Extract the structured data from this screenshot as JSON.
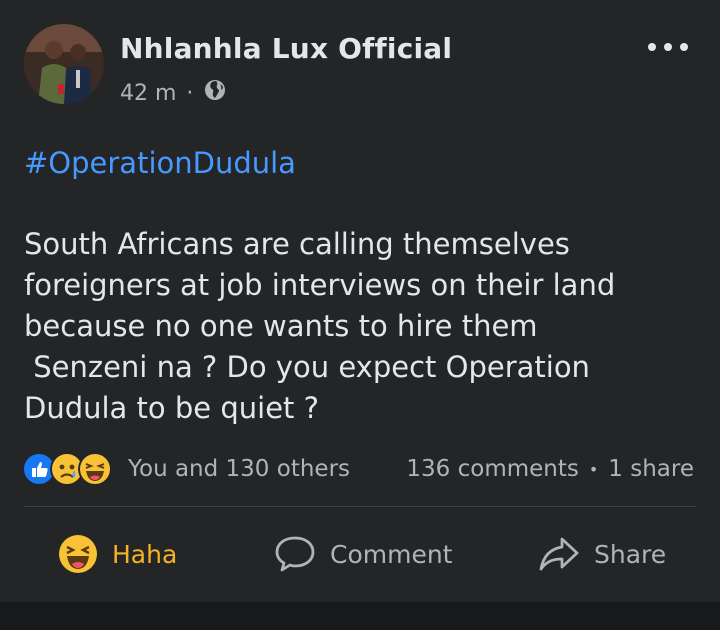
{
  "post": {
    "author": "Nhlanhla Lux Official",
    "time": "42 m",
    "separator": "·",
    "hashtag": "#OperationDudula",
    "body_lines": [
      "South Africans are calling themselves",
      "foreigners at job interviews on their land",
      "because no one wants to hire them",
      " Senzeni na ? Do you expect Operation",
      "Dudula to be quiet ?"
    ]
  },
  "reactions": {
    "icons": [
      "like-icon",
      "sad-icon",
      "haha-icon"
    ],
    "summary": "You and 130 others",
    "comments": "136 comments",
    "dot": "•",
    "shares": "1 share"
  },
  "actions": {
    "haha_label": "Haha",
    "comment_label": "Comment",
    "share_label": "Share"
  },
  "colors": {
    "background": "#242526",
    "text": "#e4e6eb",
    "muted": "#b0b3b8",
    "hashtag": "#4599ff",
    "haha": "#f7b125",
    "like": "#1877f2"
  }
}
